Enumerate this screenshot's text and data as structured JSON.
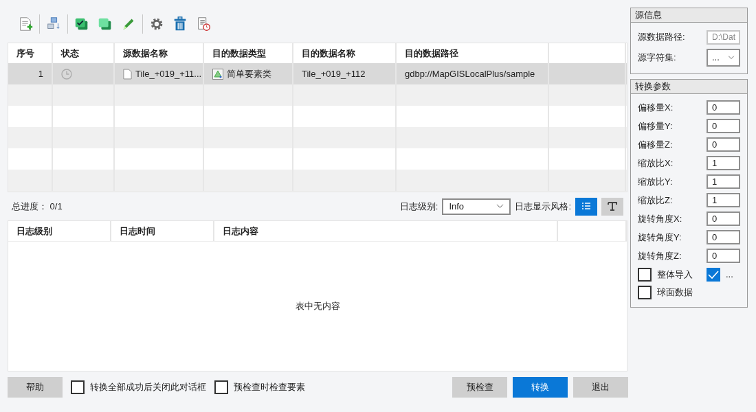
{
  "data_table": {
    "columns": [
      "序号",
      "状态",
      "源数据名称",
      "目的数据类型",
      "目的数据名称",
      "目的数据路径"
    ],
    "rows": [
      {
        "selected": true,
        "index": "1",
        "pending": true,
        "source_name": "Tile_+019_+11...",
        "target_type": "简单要素类",
        "target_name": "Tile_+019_+112",
        "target_path": "gdbp://MapGISLocalPlus/sample"
      }
    ]
  },
  "progress": {
    "label": "总进度：",
    "value": "0/1"
  },
  "log_level": {
    "label": "日志级别:",
    "value": "Info"
  },
  "log_style": {
    "label": "日志显示风格:",
    "options": [
      {
        "kind": "list",
        "selected": true
      },
      {
        "kind": "text",
        "selected": false
      }
    ]
  },
  "log_table": {
    "columns": [
      "日志级别",
      "日志时间",
      "日志内容"
    ],
    "empty_text": "表中无内容"
  },
  "source_info": {
    "title": "源信息",
    "path_label": "源数据路径:",
    "path_value": "D:\\Dat",
    "path_disabled": true,
    "charset_label": "源字符集:",
    "charset_value": "..."
  },
  "params": {
    "title": "转换参数",
    "fields": [
      {
        "label": "偏移量X:",
        "value": "0"
      },
      {
        "label": "偏移量Y:",
        "value": "0"
      },
      {
        "label": "偏移量Z:",
        "value": "0"
      },
      {
        "label": "缩放比X:",
        "value": "1"
      },
      {
        "label": "缩放比Y:",
        "value": "1"
      },
      {
        "label": "缩放比Z:",
        "value": "1"
      },
      {
        "label": "旋转角度X:",
        "value": "0"
      },
      {
        "label": "旋转角度Y:",
        "value": "0"
      },
      {
        "label": "旋转角度Z:",
        "value": "0"
      }
    ],
    "checks": [
      {
        "label": "整体导入",
        "checked": false
      },
      {
        "label": "...",
        "checked": true
      },
      {
        "label": "球面数据",
        "checked": false
      }
    ]
  },
  "footer": {
    "help": "帮助",
    "checks": [
      {
        "label": "转换全部成功后关闭此对话框",
        "checked": false
      },
      {
        "label": "预检查时检查要素",
        "checked": false
      }
    ],
    "buttons": [
      {
        "label": "预检查",
        "kind": "secondary"
      },
      {
        "label": "转换",
        "kind": "primary"
      },
      {
        "label": "退出",
        "kind": "secondary"
      }
    ]
  }
}
